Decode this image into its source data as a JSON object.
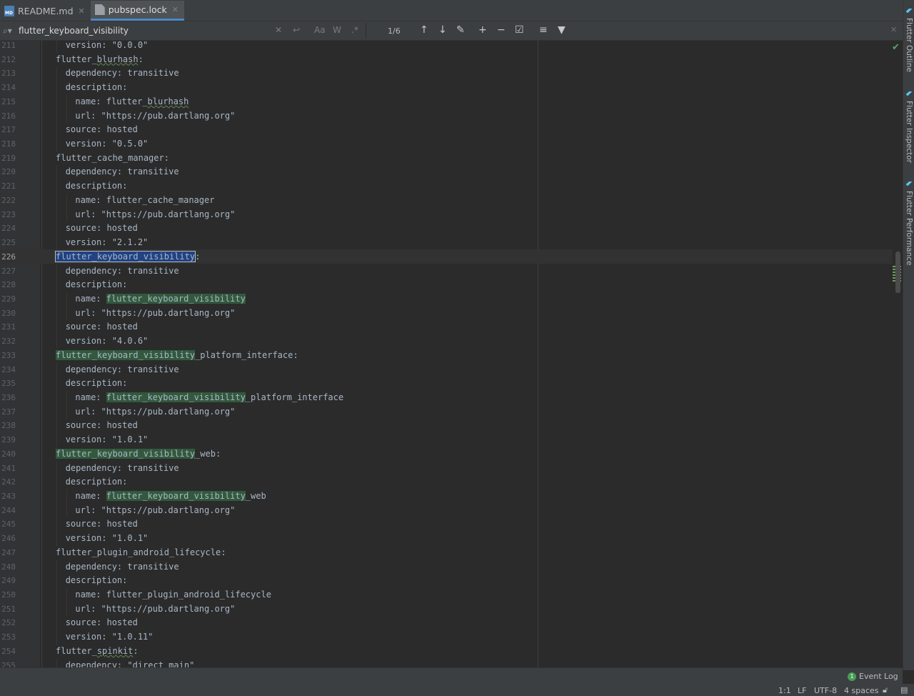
{
  "tabs": [
    {
      "label": "README.md",
      "icon": "markdown-file-icon",
      "active": false
    },
    {
      "label": "pubspec.lock",
      "icon": "lock-file-icon",
      "active": true
    }
  ],
  "find": {
    "query": "flutter_keyboard_visibility",
    "case_label": "Aa",
    "words_label": "W",
    "regex_label": ".*",
    "match_count": "1/6"
  },
  "lines": [
    {
      "n": "211",
      "d": 1,
      "t": "version: \"0.0.0\""
    },
    {
      "n": "212",
      "d": 0,
      "t": "flutter_blurhash:"
    },
    {
      "n": "213",
      "d": 1,
      "t": "dependency: transitive"
    },
    {
      "n": "214",
      "d": 1,
      "t": "description:"
    },
    {
      "n": "215",
      "d": 2,
      "t": "name: flutter_blurhash"
    },
    {
      "n": "216",
      "d": 2,
      "t": "url: \"https://pub.dartlang.org\""
    },
    {
      "n": "217",
      "d": 1,
      "t": "source: hosted"
    },
    {
      "n": "218",
      "d": 1,
      "t": "version: \"0.5.0\""
    },
    {
      "n": "219",
      "d": 0,
      "t": "flutter_cache_manager:"
    },
    {
      "n": "220",
      "d": 1,
      "t": "dependency: transitive"
    },
    {
      "n": "221",
      "d": 1,
      "t": "description:"
    },
    {
      "n": "222",
      "d": 2,
      "t": "name: flutter_cache_manager"
    },
    {
      "n": "223",
      "d": 2,
      "t": "url: \"https://pub.dartlang.org\""
    },
    {
      "n": "224",
      "d": 1,
      "t": "source: hosted"
    },
    {
      "n": "225",
      "d": 1,
      "t": "version: \"2.1.2\""
    },
    {
      "n": "226",
      "d": 0,
      "t": "flutter_keyboard_visibility:"
    },
    {
      "n": "227",
      "d": 1,
      "t": "dependency: transitive"
    },
    {
      "n": "228",
      "d": 1,
      "t": "description:"
    },
    {
      "n": "229",
      "d": 2,
      "t": "name: flutter_keyboard_visibility"
    },
    {
      "n": "230",
      "d": 2,
      "t": "url: \"https://pub.dartlang.org\""
    },
    {
      "n": "231",
      "d": 1,
      "t": "source: hosted"
    },
    {
      "n": "232",
      "d": 1,
      "t": "version: \"4.0.6\""
    },
    {
      "n": "233",
      "d": 0,
      "t": "flutter_keyboard_visibility_platform_interface:"
    },
    {
      "n": "234",
      "d": 1,
      "t": "dependency: transitive"
    },
    {
      "n": "235",
      "d": 1,
      "t": "description:"
    },
    {
      "n": "236",
      "d": 2,
      "t": "name: flutter_keyboard_visibility_platform_interface"
    },
    {
      "n": "237",
      "d": 2,
      "t": "url: \"https://pub.dartlang.org\""
    },
    {
      "n": "238",
      "d": 1,
      "t": "source: hosted"
    },
    {
      "n": "239",
      "d": 1,
      "t": "version: \"1.0.1\""
    },
    {
      "n": "240",
      "d": 0,
      "t": "flutter_keyboard_visibility_web:"
    },
    {
      "n": "241",
      "d": 1,
      "t": "dependency: transitive"
    },
    {
      "n": "242",
      "d": 1,
      "t": "description:"
    },
    {
      "n": "243",
      "d": 2,
      "t": "name: flutter_keyboard_visibility_web"
    },
    {
      "n": "244",
      "d": 2,
      "t": "url: \"https://pub.dartlang.org\""
    },
    {
      "n": "245",
      "d": 1,
      "t": "source: hosted"
    },
    {
      "n": "246",
      "d": 1,
      "t": "version: \"1.0.1\""
    },
    {
      "n": "247",
      "d": 0,
      "t": "flutter_plugin_android_lifecycle:"
    },
    {
      "n": "248",
      "d": 1,
      "t": "dependency: transitive"
    },
    {
      "n": "249",
      "d": 1,
      "t": "description:"
    },
    {
      "n": "250",
      "d": 2,
      "t": "name: flutter_plugin_android_lifecycle"
    },
    {
      "n": "251",
      "d": 2,
      "t": "url: \"https://pub.dartlang.org\""
    },
    {
      "n": "252",
      "d": 1,
      "t": "source: hosted"
    },
    {
      "n": "253",
      "d": 1,
      "t": "version: \"1.0.11\""
    },
    {
      "n": "254",
      "d": 0,
      "t": "flutter_spinkit:"
    },
    {
      "n": "255",
      "d": 1,
      "t": "dependency: \"direct main\""
    }
  ],
  "current_line": "226",
  "side_tools": [
    "Flutter Outline",
    "Flutter Inspector",
    "Flutter Performance"
  ],
  "event_log": {
    "count": "1",
    "label": "Event Log"
  },
  "status": {
    "position": "1:1",
    "line_sep": "LF",
    "encoding": "UTF-8",
    "indent": "4 spaces"
  },
  "colors": {
    "match": "#32593d",
    "current_match": "#214283",
    "background": "#2b2b2b",
    "accent": "#4a88c7"
  }
}
